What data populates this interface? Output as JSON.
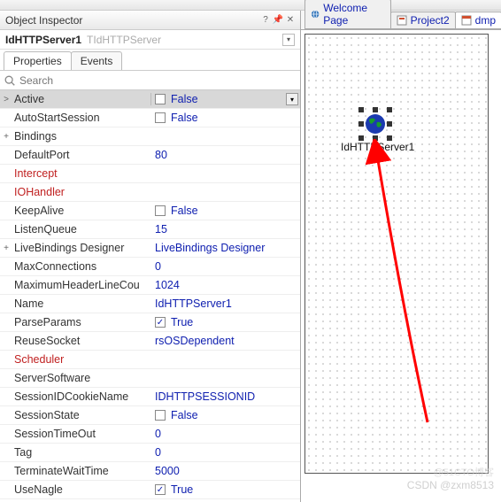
{
  "toolbar": {
    "items": 20
  },
  "inspector": {
    "title": "Object Inspector",
    "component_name": "IdHTTPServer1",
    "component_type": "TIdHTTPServer",
    "tabs": {
      "properties": "Properties",
      "events": "Events"
    },
    "search_placeholder": "Search"
  },
  "properties": [
    {
      "exp": ">",
      "name": "Active",
      "type": "bool",
      "value": "False",
      "checked": false,
      "selected": true,
      "dropdown": true
    },
    {
      "exp": "",
      "name": "AutoStartSession",
      "type": "bool",
      "value": "False",
      "checked": false
    },
    {
      "exp": "+",
      "name": "Bindings",
      "type": "plain",
      "value": ""
    },
    {
      "exp": "",
      "name": "DefaultPort",
      "type": "plain",
      "value": "80"
    },
    {
      "exp": "",
      "name": "Intercept",
      "type": "red",
      "value": ""
    },
    {
      "exp": "",
      "name": "IOHandler",
      "type": "red",
      "value": ""
    },
    {
      "exp": "",
      "name": "KeepAlive",
      "type": "bool",
      "value": "False",
      "checked": false
    },
    {
      "exp": "",
      "name": "ListenQueue",
      "type": "plain",
      "value": "15"
    },
    {
      "exp": "+",
      "name": "LiveBindings Designer",
      "type": "plain",
      "value": "LiveBindings Designer"
    },
    {
      "exp": "",
      "name": "MaxConnections",
      "type": "plain",
      "value": "0"
    },
    {
      "exp": "",
      "name": "MaximumHeaderLineCou",
      "type": "plain",
      "value": "1024"
    },
    {
      "exp": "",
      "name": "Name",
      "type": "plain",
      "value": "IdHTTPServer1"
    },
    {
      "exp": "",
      "name": "ParseParams",
      "type": "bool",
      "value": "True",
      "checked": true
    },
    {
      "exp": "",
      "name": "ReuseSocket",
      "type": "plain",
      "value": "rsOSDependent"
    },
    {
      "exp": "",
      "name": "Scheduler",
      "type": "red",
      "value": ""
    },
    {
      "exp": "",
      "name": "ServerSoftware",
      "type": "plain",
      "value": ""
    },
    {
      "exp": "",
      "name": "SessionIDCookieName",
      "type": "plain",
      "value": "IDHTTPSESSIONID"
    },
    {
      "exp": "",
      "name": "SessionState",
      "type": "bool",
      "value": "False",
      "checked": false
    },
    {
      "exp": "",
      "name": "SessionTimeOut",
      "type": "plain",
      "value": "0"
    },
    {
      "exp": "",
      "name": "Tag",
      "type": "plain",
      "value": "0"
    },
    {
      "exp": "",
      "name": "TerminateWaitTime",
      "type": "plain",
      "value": "5000"
    },
    {
      "exp": "",
      "name": "UseNagle",
      "type": "bool",
      "value": "True",
      "checked": true
    }
  ],
  "designer": {
    "tabs": {
      "welcome": "Welcome Page",
      "project": "Project2",
      "dmp": "dmp"
    },
    "component_label": "IdHTTPServer1"
  },
  "watermark": "CSDN @zxm8513",
  "watermark2": "@51CTO博客"
}
